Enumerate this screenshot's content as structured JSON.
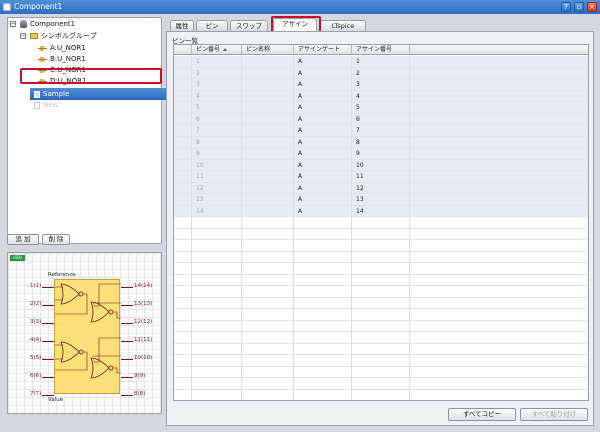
{
  "window": {
    "title": "Component1"
  },
  "tree": {
    "root": "Component1",
    "group": "シンボルグループ",
    "symbols": [
      "A:U_NOR1",
      "B:U_NOR1",
      "C:U_NOR1",
      "D:U_NOR1"
    ],
    "selected": "Sample",
    "faded": "New"
  },
  "buttons": {
    "add": "追 加",
    "delete": "削 除",
    "copy_all": "すべてコピー",
    "paste_all": "すべて貼り付け"
  },
  "preview": {
    "badge": "UiDe",
    "reference": "Reference",
    "value": "Value",
    "left_pins": [
      "1(1)",
      "2(2)",
      "3(3)",
      "4(4)",
      "5(5)",
      "6(6)",
      "7(7)"
    ],
    "right_pins": [
      "14(14)",
      "13(13)",
      "12(12)",
      "11(11)",
      "10(10)",
      "9(9)",
      "8(8)"
    ]
  },
  "tabs": [
    "属性",
    "ピン",
    "スワップ",
    "アサイン",
    "LTspice"
  ],
  "active_tab": "アサイン",
  "group_label": "ピン一覧",
  "table": {
    "columns": [
      "ピン番号",
      "ピン名称",
      "アサインゲート",
      "アサイン番号"
    ],
    "rows": [
      [
        "1",
        "",
        "A",
        "1"
      ],
      [
        "2",
        "",
        "A",
        "2"
      ],
      [
        "3",
        "",
        "A",
        "3"
      ],
      [
        "4",
        "",
        "A",
        "4"
      ],
      [
        "5",
        "",
        "A",
        "5"
      ],
      [
        "6",
        "",
        "A",
        "6"
      ],
      [
        "7",
        "",
        "A",
        "7"
      ],
      [
        "8",
        "",
        "A",
        "8"
      ],
      [
        "9",
        "",
        "A",
        "9"
      ],
      [
        "10",
        "",
        "A",
        "10"
      ],
      [
        "11",
        "",
        "A",
        "11"
      ],
      [
        "12",
        "",
        "A",
        "12"
      ],
      [
        "13",
        "",
        "A",
        "13"
      ],
      [
        "14",
        "",
        "A",
        "14"
      ]
    ]
  }
}
